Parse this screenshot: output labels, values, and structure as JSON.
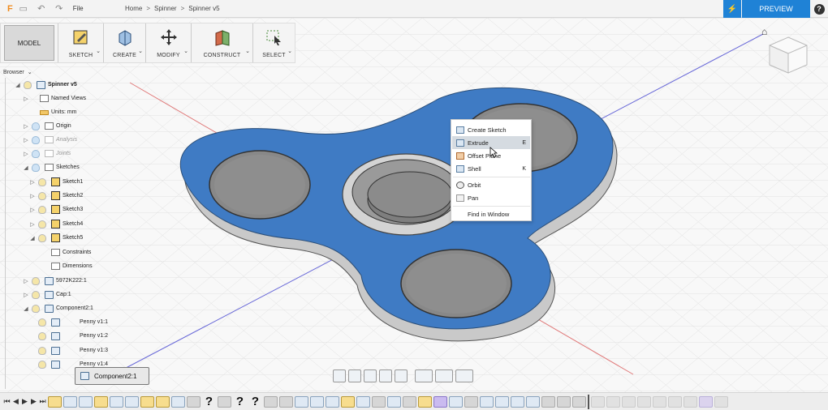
{
  "titlebar": {
    "file_label": "File",
    "breadcrumb": [
      "Home",
      "Spinner",
      "Spinner v5"
    ],
    "preview_label": "PREVIEW",
    "help_label": "?"
  },
  "toolbar": {
    "workspace": "MODEL",
    "groups": [
      {
        "label": "SKETCH",
        "icon": "sketch-icon"
      },
      {
        "label": "CREATE",
        "icon": "create-icon"
      },
      {
        "label": "MODIFY",
        "icon": "modify-icon"
      },
      {
        "label": "CONSTRUCT",
        "icon": "construct-icon"
      },
      {
        "label": "SELECT",
        "icon": "select-icon"
      }
    ]
  },
  "browser": {
    "title": "Browser",
    "items": [
      {
        "label": "Spinner v5"
      },
      {
        "label": "Named Views"
      },
      {
        "label": "Units: mm"
      },
      {
        "label": "Origin"
      },
      {
        "label": "Analysis"
      },
      {
        "label": "Joints"
      },
      {
        "label": "Sketches"
      },
      {
        "label": "Sketch1"
      },
      {
        "label": "Sketch2"
      },
      {
        "label": "Sketch3"
      },
      {
        "label": "Sketch4"
      },
      {
        "label": "Sketch5"
      },
      {
        "label": "Constraints"
      },
      {
        "label": "Dimensions"
      },
      {
        "label": "5972K222:1"
      },
      {
        "label": "Cap:1"
      },
      {
        "label": "Component2:1"
      },
      {
        "label": "Penny v1:1"
      },
      {
        "label": "Penny v1:2"
      },
      {
        "label": "Penny v1:3"
      },
      {
        "label": "Penny v1:4"
      }
    ]
  },
  "context_menu": {
    "items": [
      {
        "label": "Create Sketch",
        "shortcut": ""
      },
      {
        "label": "Extrude",
        "shortcut": "E"
      },
      {
        "label": "Offset Plane",
        "shortcut": ""
      },
      {
        "label": "Shell",
        "shortcut": "K"
      },
      {
        "label": "Orbit",
        "shortcut": ""
      },
      {
        "label": "Pan",
        "shortcut": ""
      },
      {
        "label": "Find in Window",
        "shortcut": ""
      }
    ]
  },
  "component_tip": {
    "label": "Component2:1"
  },
  "colors": {
    "accent_blue": "#1f82d6",
    "spinner_blue": "#3f7bc4",
    "bearing_gray": "#8f8f8f",
    "highlight": "#d5dbe1"
  }
}
